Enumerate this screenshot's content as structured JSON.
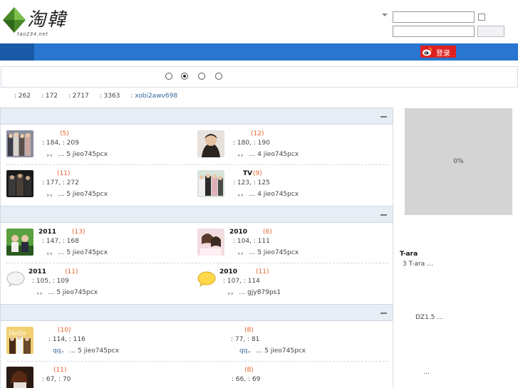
{
  "header": {
    "logo_text": "tao234.net"
  },
  "nav": {
    "weibo_login_label": "登录"
  },
  "slider": {
    "dots": 4,
    "active_index": 1
  },
  "stats": {
    "s1": ": 262",
    "s2": ": 172",
    "s3": ": 2717",
    "s4": ": 3363",
    "newest_prefix": ": ",
    "newest_user": "xobi2awv698"
  },
  "categories": [
    {
      "forums": [
        {
          "name": "",
          "today": "(5)",
          "stats": ": 184,  : 209",
          "last": "，，  … 5    jieo745pcx"
        },
        {
          "name": "",
          "today": "(12)",
          "stats": ": 180,  : 190",
          "last": "，，  … 4    jieo745pcx"
        },
        {
          "name": "",
          "today": "(11)",
          "stats": ": 177,  : 272",
          "last": "，，  … 5    jieo745pcx"
        },
        {
          "name": "TV",
          "today": "(9)",
          "stats": ": 123,  : 125",
          "last": "，，  … 4    jieo745pcx"
        }
      ]
    },
    {
      "forums": [
        {
          "name": "2011",
          "today": "(13)",
          "stats": ": 147,  : 168",
          "last": "，，  … 5    jieo745pcx"
        },
        {
          "name": "2010",
          "today": "(6)",
          "stats": ": 104,  : 111",
          "last": "，，  … 5    jieo745pcx"
        },
        {
          "name": "2011",
          "today": "(11)",
          "stats": ": 105,  : 109",
          "last": "，，  … 5    jieo745pcx"
        },
        {
          "name": "2010",
          "today": "(11)",
          "stats": ": 107,  : 114",
          "last": "，，  …    gjy879ps1"
        }
      ]
    },
    {
      "forums": [
        {
          "name": "",
          "today": "(10)",
          "stats": ": 114,  : 116",
          "last_qq": "qq",
          "last": "，  … 5    jieo745pcx"
        },
        {
          "name": "",
          "today": "(8)",
          "stats": ": 77,  : 81",
          "last_qq": "qq",
          "last": "，  … 5    jieo745pcx"
        },
        {
          "name": "",
          "today": "(11)",
          "stats": ": 67,  : 70",
          "last": ""
        },
        {
          "name": "",
          "today": "(8)",
          "stats": ": 66,  : 69",
          "last": ""
        }
      ]
    }
  ],
  "sidebar": {
    "progress_label": "0%",
    "hot_title": "T-ara",
    "hot_line": "3    T-ara    …",
    "dz_line": "DZ1.5  …",
    "more": "…"
  },
  "colors": {
    "nav_blue": "#2876cf",
    "today_orange": "#e8622a",
    "link_blue": "#336699",
    "weibo_red": "#e02020"
  }
}
